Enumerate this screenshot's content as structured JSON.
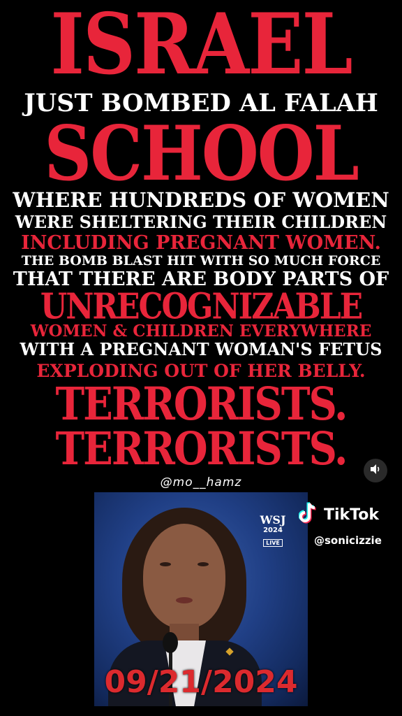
{
  "poster": {
    "lines": [
      {
        "text": "ISRAEL",
        "style": "big-red"
      },
      {
        "text": "JUST BOMBED AL FALAH",
        "style": "white"
      },
      {
        "text": "SCHOOL",
        "style": "big-red"
      },
      {
        "text": "WHERE HUNDREDS OF WOMEN",
        "style": "white"
      },
      {
        "text": "WERE SHELTERING THEIR CHILDREN",
        "style": "white"
      },
      {
        "text": "INCLUDING PREGNANT WOMEN.",
        "style": "red"
      },
      {
        "text": "THE BOMB BLAST HIT WITH SO MUCH FORCE",
        "style": "white"
      },
      {
        "text": "THAT THERE ARE BODY PARTS OF",
        "style": "white"
      },
      {
        "text": "UNRECOGNIZABLE",
        "style": "big-red"
      },
      {
        "text": "WOMEN & CHILDREN EVERYWHERE",
        "style": "red"
      },
      {
        "text": "WITH A PREGNANT WOMAN'S FETUS",
        "style": "white"
      },
      {
        "text": "EXPLODING OUT OF HER BELLY.",
        "style": "red"
      },
      {
        "text": "TERRORISTS.",
        "style": "big-red"
      },
      {
        "text": "TERRORISTS.",
        "style": "big-red"
      }
    ],
    "watermark": "@mo__hamz"
  },
  "video": {
    "channel_logo": "WSJ",
    "year": "2024",
    "live_badge": "LIVE",
    "date_overlay": "09/21/2024"
  },
  "tiktok": {
    "brand": "TikTok",
    "handle": "@sonicizzie",
    "icon": "tiktok-note-icon"
  },
  "controls": {
    "sound_icon": "speaker-icon"
  },
  "colors": {
    "background": "#000000",
    "accent_red": "#e8253a",
    "date_red": "#dc2a2e",
    "text_white": "#ffffff"
  }
}
